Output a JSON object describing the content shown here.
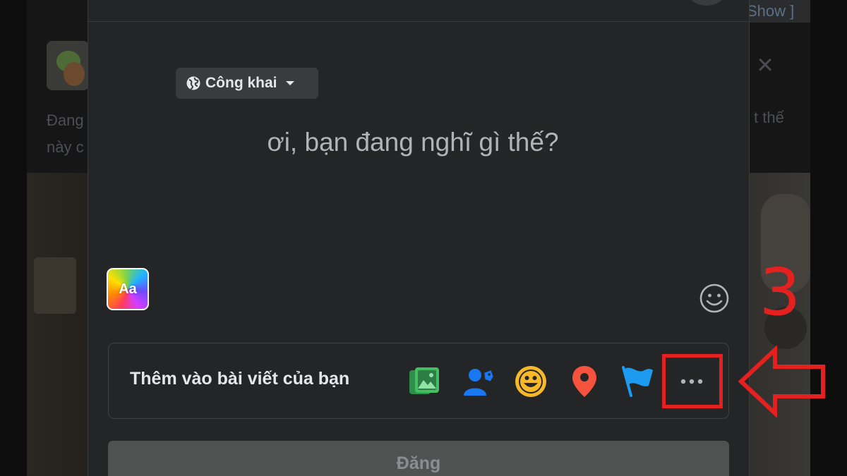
{
  "background": {
    "show_label": "Show ]",
    "text_left": "Đang\nnày c",
    "text_right": "t thế"
  },
  "composer": {
    "audience_label": "Công khai",
    "placeholder": "ơi, bạn đang nghĩ gì thế?",
    "text_format_label": "Aa",
    "add_to_post_label": "Thêm vào bài viết của bạn",
    "post_button_label": "Đăng"
  },
  "annotation": {
    "step_number": "3"
  },
  "colors": {
    "modal_bg": "#242526",
    "annotation_red": "#e5211f",
    "photo_green": "#45bd62",
    "tag_blue": "#1877f2",
    "feeling_yellow": "#f7b928",
    "checkin_red": "#f5533d",
    "flag_blue": "#1d9bf0"
  }
}
